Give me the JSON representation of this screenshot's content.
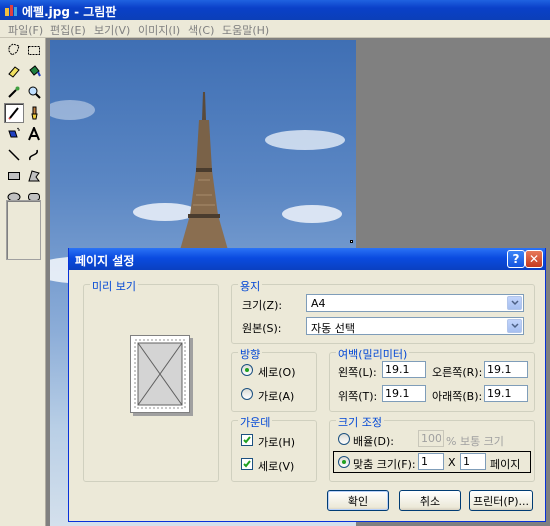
{
  "window": {
    "title": "에펠.jpg - 그림판"
  },
  "menu": [
    "파일(F)",
    "편집(E)",
    "보기(V)",
    "이미지(I)",
    "색(C)",
    "도움말(H)"
  ],
  "tools": [
    "free-form-select",
    "select",
    "eraser",
    "fill",
    "color-picker",
    "magnifier",
    "pencil",
    "brush",
    "airbrush",
    "text",
    "line",
    "curve",
    "rectangle",
    "polygon",
    "ellipse",
    "rounded-rectangle"
  ],
  "dialog": {
    "title": "페이지 설정",
    "help_label": "?",
    "close_label": "✕",
    "preview": {
      "legend": "미리 보기"
    },
    "paper": {
      "legend": "용지",
      "size_label": "크기(Z):",
      "size_value": "A4",
      "source_label": "원본(S):",
      "source_value": "자동 선택"
    },
    "orientation": {
      "legend": "방향",
      "portrait_label": "세로(O)",
      "landscape_label": "가로(A)",
      "selected": "portrait"
    },
    "margins": {
      "legend": "여백(밀리미터)",
      "left_label": "왼쪽(L):",
      "left_value": "19.1",
      "right_label": "오른쪽(R):",
      "right_value": "19.1",
      "top_label": "위쪽(T):",
      "top_value": "19.1",
      "bottom_label": "아래쪽(B):",
      "bottom_value": "19.1"
    },
    "centering": {
      "legend": "가운데",
      "horizontal_label": "가로(H)",
      "horizontal_checked": true,
      "vertical_label": "세로(V)",
      "vertical_checked": true
    },
    "scaling": {
      "legend": "크기 조정",
      "adjust_label": "배율(D):",
      "adjust_value": "100",
      "adjust_suffix": "% 보통 크기",
      "fit_label": "맞춤 크기(F):",
      "fit_wide": "1",
      "fit_x": "X",
      "fit_tall": "1",
      "fit_suffix": "페이지",
      "selected": "fit"
    },
    "buttons": {
      "ok": "확인",
      "cancel": "취소",
      "printer": "프린터(P)..."
    }
  }
}
